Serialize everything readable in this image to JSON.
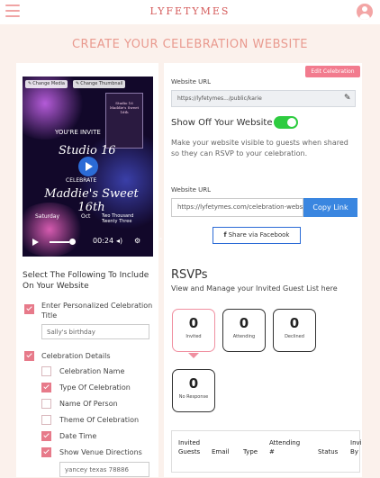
{
  "header": {
    "logo": "LYFETYMES",
    "menu_icon": "hamburger-icon",
    "user_icon": "user-avatar-icon"
  },
  "page_title": "CREATE YOUR CELEBRATION WEBSITE",
  "video": {
    "change_media": "Change Media",
    "change_thumbnail": "Change Thumbnail",
    "youre_invite": "YOU'RE INVITE",
    "studio": "Studio 16",
    "celebrate": "CELEBRATE",
    "maddie": "Maddie's Sweet 16th",
    "day": "Saturday",
    "oct": "Oct",
    "year": "Two Thousand Twenty Three",
    "time": "00:24",
    "thumbnail_text": "Studio 16 Maddie's Sweet 16th"
  },
  "left": {
    "heading": "Select The Following To Include On Your Website",
    "personalized": {
      "label": "Enter Personalized Celebration Title",
      "value": "Sally's birthday",
      "checked": true
    },
    "details_label": "Celebration Details",
    "details_checked": true,
    "items": [
      {
        "label": "Celebration Name",
        "checked": false
      },
      {
        "label": "Type Of Celebration",
        "checked": true
      },
      {
        "label": "Name Of Person",
        "checked": false
      },
      {
        "label": "Theme Of Celebration",
        "checked": false
      },
      {
        "label": "Date Time",
        "checked": true
      },
      {
        "label": "Show Venue Directions",
        "checked": true
      }
    ],
    "venue_value": "yancey texas 78886"
  },
  "right": {
    "edit_button": "Edit Celebration",
    "website_url_label": "Website URL",
    "website_url_value": "https://lyfetymes.../public/karie",
    "show_off_label": "Show Off Your Website",
    "show_off_enabled": true,
    "description": "Make your website visible to guests when shared so they can RSVP to your celebration.",
    "website_url_label_2": "Website URL",
    "copy_url_value": "https://lyfetymes.com/celebration-website",
    "copy_button": "Copy Link",
    "facebook_button": "Share via Facebook",
    "rsvp_title": "RSVPs",
    "rsvp_subtitle": "View and Manage your Invited Guest List here",
    "stats": [
      {
        "count": "0",
        "label": "Invited"
      },
      {
        "count": "0",
        "label": "Attending"
      },
      {
        "count": "0",
        "label": "Declined"
      },
      {
        "count": "0",
        "label": "No Response"
      }
    ],
    "table_headers": [
      "Invited Guests",
      "Email",
      "Type",
      "Attending #",
      "Status",
      "Invited By"
    ]
  },
  "colors": {
    "accent": "#f27b8e",
    "toggle_on": "#2ecc40",
    "link_blue": "#3a86e0",
    "title": "#e99a8f"
  }
}
